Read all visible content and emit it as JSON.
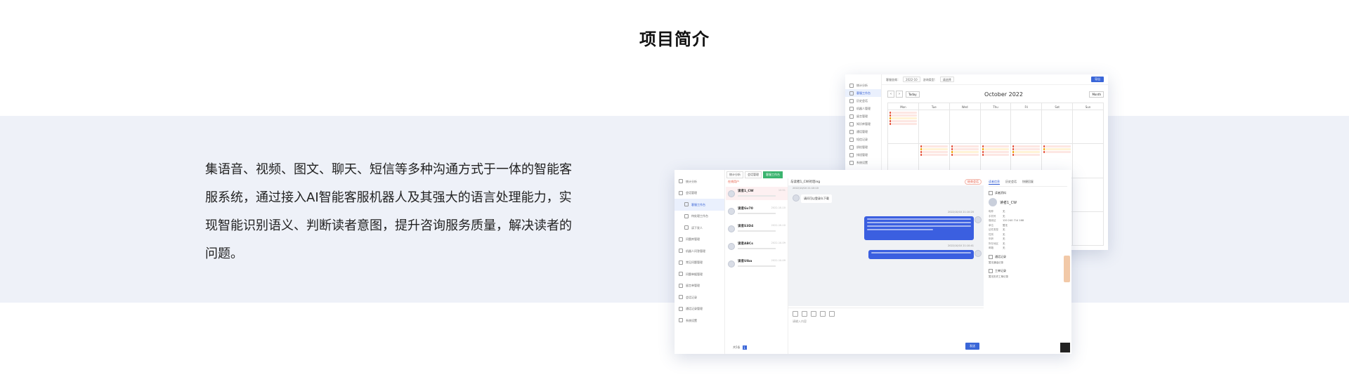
{
  "section": {
    "title": "项目简介",
    "description_lines": [
      "集语音、视频、图文、聊天、短信等多种沟通方式于一体的智能客",
      "服系统，通过接入AI智能客服机器人及其强大的语言处理能力，实",
      "现智能识别语义、判断读者意图，提升咨询服务质量，解决读者的",
      "问题。"
    ]
  },
  "calendar_window": {
    "sidebar_items": [
      "统计分析",
      "客服工作台",
      "历史会话",
      "机器人管理",
      "留言管理",
      "知识库管理",
      "通话管理",
      "短信记录",
      "质检管理",
      "排班管理",
      "系统设置"
    ],
    "filters": [
      "客服坐席：",
      "2022-10",
      "咨询类型：",
      "请选择"
    ],
    "primary_button": "导出",
    "today_button": "Today",
    "month_title": "October 2022",
    "view_button": "Month",
    "weekdays": [
      "Mon",
      "Tue",
      "Wed",
      "Thu",
      "Fri",
      "Sat",
      "Sun"
    ]
  },
  "chat_window": {
    "sidebar_items": [
      "统计分析",
      "会话管理",
      "客服工作台",
      "待处理工作台",
      "读下发人",
      "问题库管理",
      "机器人问答管理",
      "常见问题管理",
      "问题单据管理",
      "留言单管理",
      "会话记录",
      "通话记录管理",
      "系统设置"
    ],
    "active_sidebar_index": 2,
    "tabs": [
      "统计分析",
      "会话管理",
      "客服工作台"
    ],
    "active_tab_index": 2,
    "list_header": "在线用户",
    "contacts": [
      {
        "name": "读者1_CW",
        "time": "10:51"
      },
      {
        "name": "读者Gv70",
        "time": "2022-10-10"
      },
      {
        "name": "读者S3D4",
        "time": "2022-10-10"
      },
      {
        "name": "读者ABCs",
        "time": "2022-10-09"
      },
      {
        "name": "读者Ulba",
        "time": "2022-10-09"
      }
    ],
    "pager": {
      "total": "共5条",
      "page": "1"
    },
    "conversation": {
      "header_user": "与读者1_CW对话ing",
      "header_tag": "结束会话",
      "timestamp_1": "2022/10/10 21:10:10",
      "reader_message": "请问可以登录么下载",
      "timestamp_2": "2022/10/10 21:10:20",
      "timestamp_3": "2022/10/10 21:10:41"
    },
    "compose_placeholder": "请输入内容",
    "send_button": "发送",
    "info_tabs": [
      "读者信息",
      "历史会话",
      "快捷回复"
    ],
    "info_section_reader": "读者资料",
    "reader_name": "读者1_CW",
    "reader_fields": [
      {
        "k": "昵称",
        "v": "无"
      },
      {
        "k": "手机号",
        "v": "无"
      },
      {
        "k": "借阅证",
        "v": "120 240 714 168"
      },
      {
        "k": "单位",
        "v": "暂无"
      },
      {
        "k": "证件类型",
        "v": "无"
      },
      {
        "k": "性别",
        "v": "无"
      },
      {
        "k": "年龄",
        "v": "无"
      },
      {
        "k": "所在地区",
        "v": "无"
      },
      {
        "k": "邮箱",
        "v": "无"
      }
    ],
    "info_section_history": "通话记录",
    "history_text": "暂无通话记录",
    "info_section_ticket": "工单记录",
    "ticket_text": "暂无历史工单记录"
  }
}
